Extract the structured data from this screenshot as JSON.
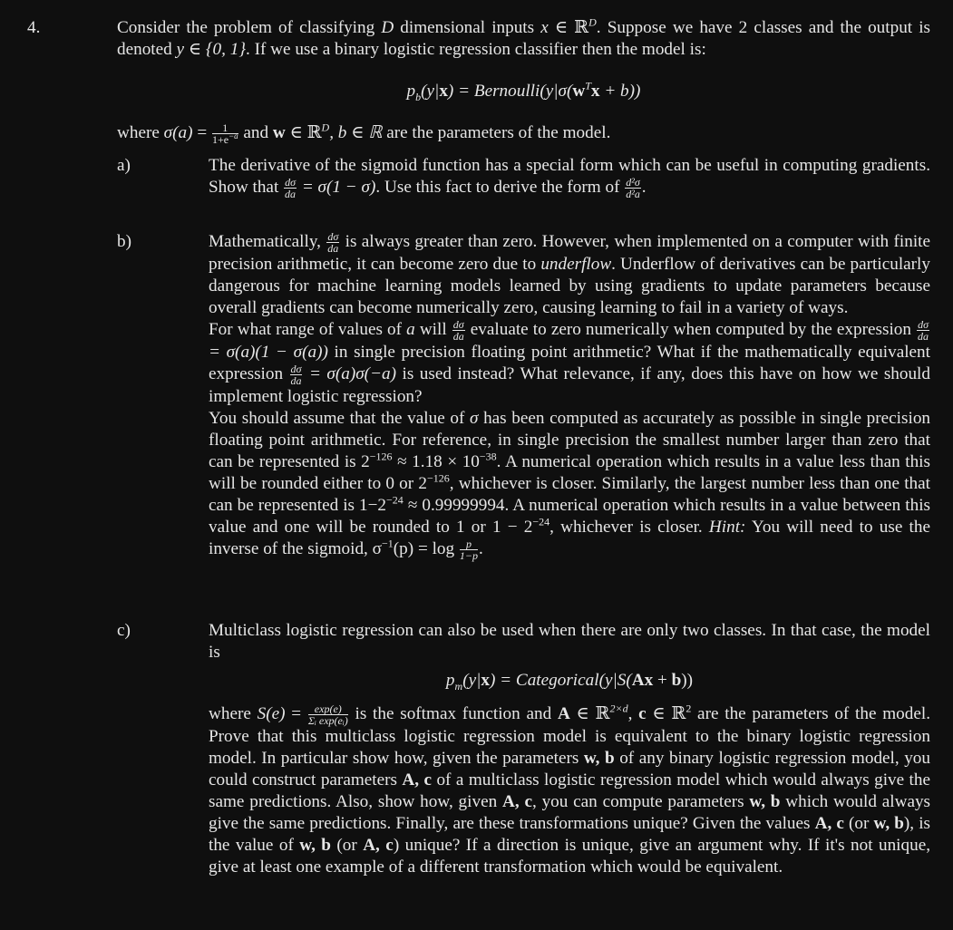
{
  "problem": {
    "number": "4.",
    "intro_line1": "Consider the problem of classifying D dimensional inputs x ∈ ℝᴰ. Suppose we have 2 classes and the output is denoted y ∈ {0, 1}. If we use a binary logistic regression classifier then the model is:",
    "model_equation": "p_b(y|x) = Bernoulli(y|σ(wᵀx + b))",
    "where_line": "where σ(a) = 1/(1+e^−a) and w ∈ ℝᴰ, b ∈ ℝ are the parameters of the model."
  },
  "parts": [
    {
      "label": "a)",
      "text": "The derivative of the sigmoid function has a special form which can be useful in computing gradients. Show that dσ/da = σ(1 − σ). Use this fact to derive the form of d²σ/d²a."
    },
    {
      "label": "b)",
      "para1": "Mathematically, dσ/da is always greater than zero. However, when implemented on a computer with finite precision arithmetic, it can become zero due to underflow. Underflow of derivatives can be particularly dangerous for machine learning models learned by using gradients to update parameters because overall gradients can become numerically zero, causing learning to fail in a variety of ways.",
      "para2": "For what range of values of a will dσ/da evaluate to zero numerically when computed by the expression dσ/da = σ(a)(1 − σ(a)) in single precision floating point arithmetic? What if the mathematically equivalent expression dσ/da = σ(a)σ(−a) is used instead? What relevance, if any, does this have on how we should implement logistic regression?",
      "para3": "You should assume that the value of σ has been computed as accurately as possible in single precision floating point arithmetic. For reference, in single precision the smallest number larger than zero that can be represented is 2⁻¹²⁶ ≈ 1.18 × 10⁻³⁸. A numerical operation which results in a value less than this will be rounded either to 0 or 2⁻¹²⁶, whichever is closer. Similarly, the largest number less than one that can be represented is 1−2⁻²⁴ ≈ 0.99999994. A numerical operation which results in a value between this value and one will be rounded to 1 or 1 − 2⁻²⁴, whichever is closer. Hint: You will need to use the inverse of the sigmoid, σ⁻¹(p) = log p/(1−p)."
    },
    {
      "label": "c)",
      "para1": "Multiclass logistic regression can also be used when there are only two classes. In that case, the model is",
      "equation": "p_m(y|x) = Categorical(y|S(Ax + b))",
      "para2": "where S(e) = exp(e)/Σᵢ exp(eᵢ) is the softmax function and A ∈ ℝ²ˣᵈ, c ∈ ℝ² are the parameters of the model. Prove that this multiclass logistic regression model is equivalent to the binary logistic regression model. In particular show how, given the parameters w, b of any binary logistic regression model, you could construct parameters A, c of a multiclass logistic regression model which would always give the same predictions. Also, show how, given A, c, you can compute parameters w, b which would always give the same predictions. Finally, are these transformations unique? Given the values A, c (or w, b), is the value of w, b (or A, c) unique? If a direction is unique, give an argument why. If it's not unique, give at least one example of a different transformation which would be equivalent."
    }
  ],
  "words": {
    "consider": "Consider the problem of classifying",
    "D": "D",
    "dim_inputs": "dimensional inputs",
    "x": "x",
    "in_RD": " ∈ ℝ",
    "suppose": ". Suppose we have 2 classes and the output is denoted",
    "y_in": "y ∈ {0, 1}",
    "if_we_use": ". If we use a binary logistic regression classifier then the model is:",
    "eq1_p": "p",
    "eq1_sub": "b",
    "eq1_rest1": "(y|",
    "eq1_x": "x",
    "eq1_rest2": ") = Bernoulli(y|σ(",
    "eq1_w": "w",
    "eq1_T": "T",
    "eq1_x2": "x",
    "eq1_rest3": " + b))",
    "where": "where ",
    "sigma_a": "σ(a)",
    "eq": " = ",
    "one": "1",
    "one_plus": "1+e",
    "neg_a": "−a",
    "and": " and ",
    "w": "w",
    "in_R": " ∈ ℝ",
    "comma_b": ", b ∈ ℝ",
    "params": " are the parameters of the model.",
    "a_l1": "The derivative of the sigmoid function has a special form which can be useful in computing gradients. Show that ",
    "dsigma": "dσ",
    "da": "da",
    "a_eq": " = σ(1 − σ)",
    "a_l2": ". Use this fact to derive the form of ",
    "d2sigma": "d²σ",
    "d2a": "d²a",
    "period": ".",
    "b_p1_pre": "Mathematically, ",
    "b_p1_a": " is always greater than zero. However, when implemented on a computer with finite precision arithmetic, it can become zero due to ",
    "underflow": "underflow",
    "b_p1_b": ". Underflow of derivatives can be particularly dangerous for machine learning models learned by using gradients to update parameters because overall gradients can become numerically zero, causing learning to fail in a variety of ways.",
    "b_p2_a": "For what range of values of ",
    "a_var": "a",
    "b_p2_b": " will ",
    "b_p2_c": " evaluate to zero numerically when computed by the expression ",
    "b_p2_d": " = σ(a)(1 − σ(a))",
    "b_p2_e": " in single precision floating point arithmetic? What if the mathematically equivalent expression ",
    "b_p2_f": " = σ(a)σ(−a)",
    "b_p2_g": " is used instead? What relevance, if any, does this have on how we should implement logistic regression?",
    "b_p3_a": "You should assume that the value of ",
    "sigma": "σ",
    "b_p3_b": " has been computed as accurately as possible in single precision floating point arithmetic. For reference, in single precision the smallest number larger than zero that can be represented is 2",
    "m126": "−126",
    "b_p3_c": " ≈ 1.18 × 10",
    "m38": "−38",
    "b_p3_d": ". A numerical operation which results in a value less than this will be rounded either to 0 or 2",
    "b_p3_e": ", whichever is closer. Similarly, the largest number less than one that can be represented is 1−2",
    "m24": "−24",
    "b_p3_f": " ≈ 0.99999994. A numerical operation which results in a value between this value and one will be rounded to 1 or 1 − 2",
    "b_p3_g": ", whichever is closer. ",
    "hint": "Hint:",
    "b_p3_h": " You will need to use the inverse of the sigmoid, σ",
    "m1": "−1",
    "b_p3_i": "(p) = log ",
    "p": "p",
    "one_minus_p": "1−p",
    "c_p1": "Multiclass logistic regression can also be used when there are only two classes. In that case, the model is",
    "eq2_p": "p",
    "eq2_sub": "m",
    "eq2_a": "(y|",
    "eq2_b": ") = Categorical(y|S(",
    "A": "A",
    "eq2_c": " + ",
    "bvec": "b",
    "eq2_d": "))",
    "c_p2_a": "where ",
    "S_e": "S(e)",
    "exp_e": "exp(e)",
    "sum_exp": "Σᵢ exp(eᵢ)",
    "c_p2_b": " is the softmax function and ",
    "in_R2xd": " ∈ ℝ",
    "sup_2xd": "2×d",
    "comma_c": ", ",
    "c": "c",
    "sup_2": "2",
    "c_p2_c": " are the parameters of the model. Prove that this multiclass logistic regression model is equivalent to the binary logistic regression model. In particular show how, given the parameters ",
    "wb": "w, b",
    "c_p2_d": " of any binary logistic regression model, you could construct parameters ",
    "Ac": "A, c",
    "c_p2_e": " of a multiclass logistic regression model which would always give the same predictions. Also, show how, given ",
    "c_p2_f": ", you can compute parameters ",
    "c_p2_g": " which would always give the same predictions. Finally, are these transformations unique? Given the values ",
    "c_p2_h": " (or ",
    "c_p2_i": "), is the value of ",
    "c_p2_j": ")",
    "c_p2_k": " unique? If a direction is unique, give an argument why. If it's not unique, give at least one example of a different transformation which would be equivalent."
  }
}
